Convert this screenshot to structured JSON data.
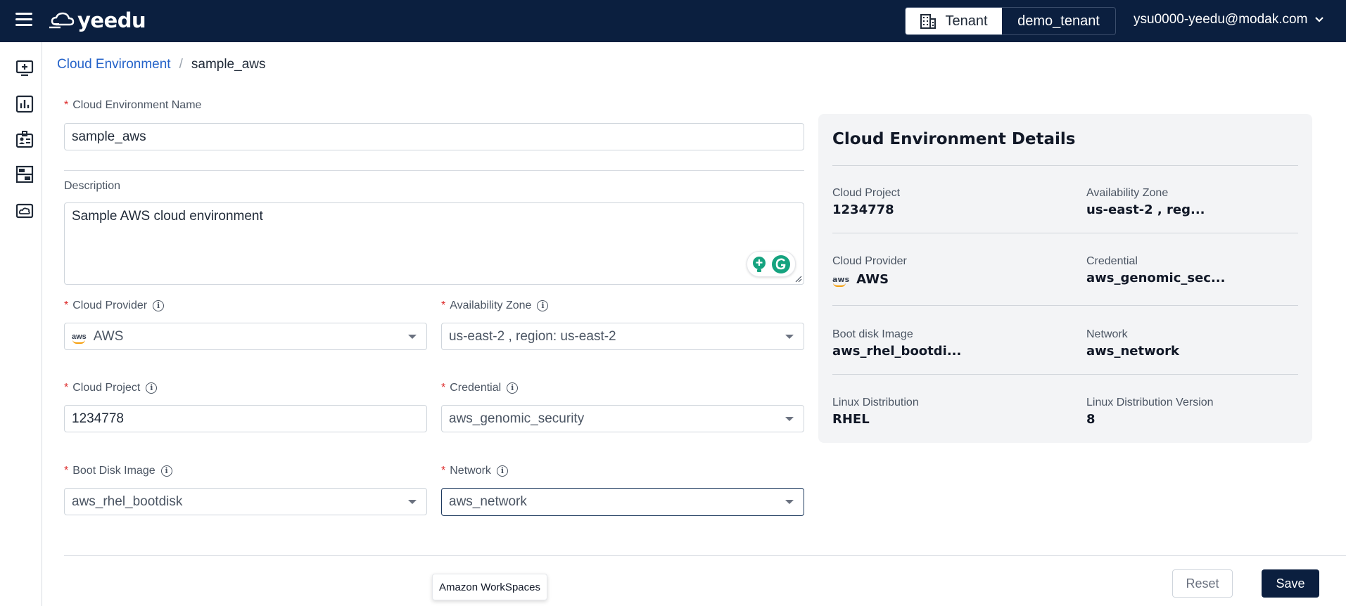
{
  "app": {
    "logo_text": "yeedu"
  },
  "header": {
    "tenant_label": "Tenant",
    "tenant_value": "demo_tenant",
    "user_email": "ysu0000-yeedu@modak.com"
  },
  "sidebar": {
    "items": [
      {
        "icon": "add-screen-icon"
      },
      {
        "icon": "bar-chart-icon"
      },
      {
        "icon": "id-badge-icon"
      },
      {
        "icon": "server-rack-icon"
      },
      {
        "icon": "cloud-monitor-icon"
      }
    ]
  },
  "breadcrumb": {
    "parent": "Cloud Environment",
    "separator": "/",
    "current": "sample_aws"
  },
  "form": {
    "name_label": "Cloud Environment Name",
    "name_value": "sample_aws",
    "description_label": "Description",
    "description_value": "Sample AWS cloud environment",
    "cloud_provider_label": "Cloud Provider",
    "cloud_provider_value": "AWS",
    "availability_zone_label": "Availability Zone",
    "availability_zone_value": "us-east-2 , region: us-east-2",
    "cloud_project_label": "Cloud Project",
    "cloud_project_value": "1234778",
    "credential_label": "Credential",
    "credential_value": "aws_genomic_security",
    "boot_disk_label": "Boot Disk Image",
    "boot_disk_value": "aws_rhel_bootdisk",
    "network_label": "Network",
    "network_value": "aws_network",
    "required_marker": "*",
    "aws_logo_text": "aws"
  },
  "details": {
    "title": "Cloud Environment Details",
    "cloud_project_label": "Cloud Project",
    "cloud_project_value": "1234778",
    "availability_zone_label": "Availability Zone",
    "availability_zone_value": "us-east-2 , reg...",
    "cloud_provider_label": "Cloud Provider",
    "cloud_provider_value": "AWS",
    "credential_label": "Credential",
    "credential_value": "aws_genomic_sec...",
    "boot_disk_label": "Boot disk Image",
    "boot_disk_value": "aws_rhel_bootdi...",
    "network_label": "Network",
    "network_value": "aws_network",
    "linux_dist_label": "Linux Distribution",
    "linux_dist_value": "RHEL",
    "linux_version_label": "Linux Distribution Version",
    "linux_version_value": "8"
  },
  "footer": {
    "tooltip": "Amazon WorkSpaces",
    "reset_label": "Reset",
    "save_label": "Save"
  },
  "colors": {
    "header_bg": "#0b1f3f",
    "link": "#2563c9",
    "required": "#dc2626",
    "panel_bg": "#f3f4f6",
    "save_bg": "#0b1f3f"
  }
}
